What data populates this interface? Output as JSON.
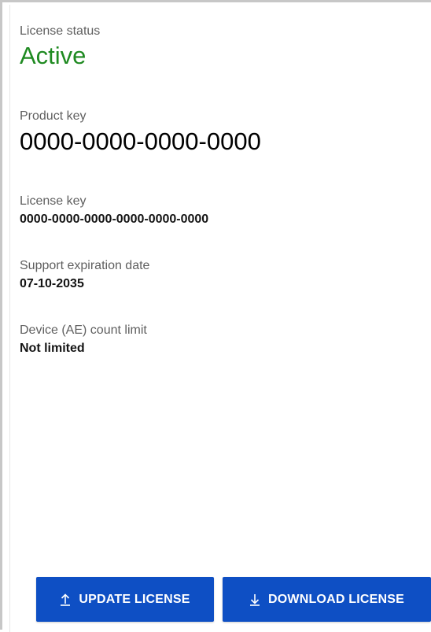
{
  "license_status": {
    "label": "License status",
    "value": "Active",
    "value_color": "#1f8a21"
  },
  "product_key": {
    "label": "Product key",
    "value": "0000-0000-0000-0000"
  },
  "license_key": {
    "label": "License key",
    "value": "0000-0000-0000-0000-0000-0000"
  },
  "support_expiration": {
    "label": "Support expiration date",
    "value": "07-10-2035"
  },
  "device_limit": {
    "label": "Device (AE) count limit",
    "value": "Not limited"
  },
  "actions": {
    "update_label": "UPDATE LICENSE",
    "update_icon": "upload-icon",
    "download_label": "DOWNLOAD LICENSE",
    "download_icon": "download-icon",
    "button_color": "#0e4fc4"
  }
}
